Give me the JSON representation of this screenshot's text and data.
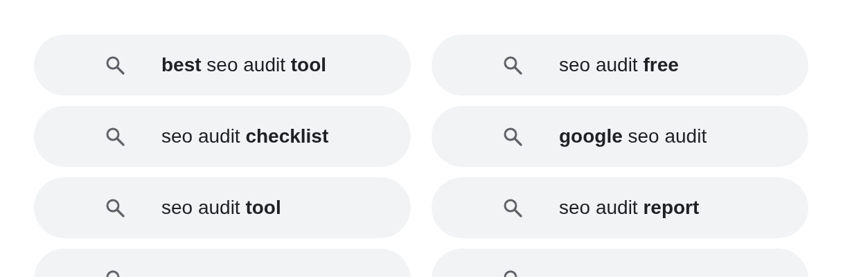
{
  "suggestions": [
    {
      "kind": "query",
      "text": "**best** seo audit **tool**"
    },
    {
      "kind": "query",
      "text": "seo audit **free**"
    },
    {
      "kind": "query",
      "text": "seo audit **checklist**"
    },
    {
      "kind": "query",
      "text": "**google** seo audit"
    },
    {
      "kind": "query",
      "text": "seo audit **tool**"
    },
    {
      "kind": "query",
      "text": "seo audit **report**"
    },
    {
      "kind": "cut_off"
    },
    {
      "kind": "cut_off"
    }
  ]
}
